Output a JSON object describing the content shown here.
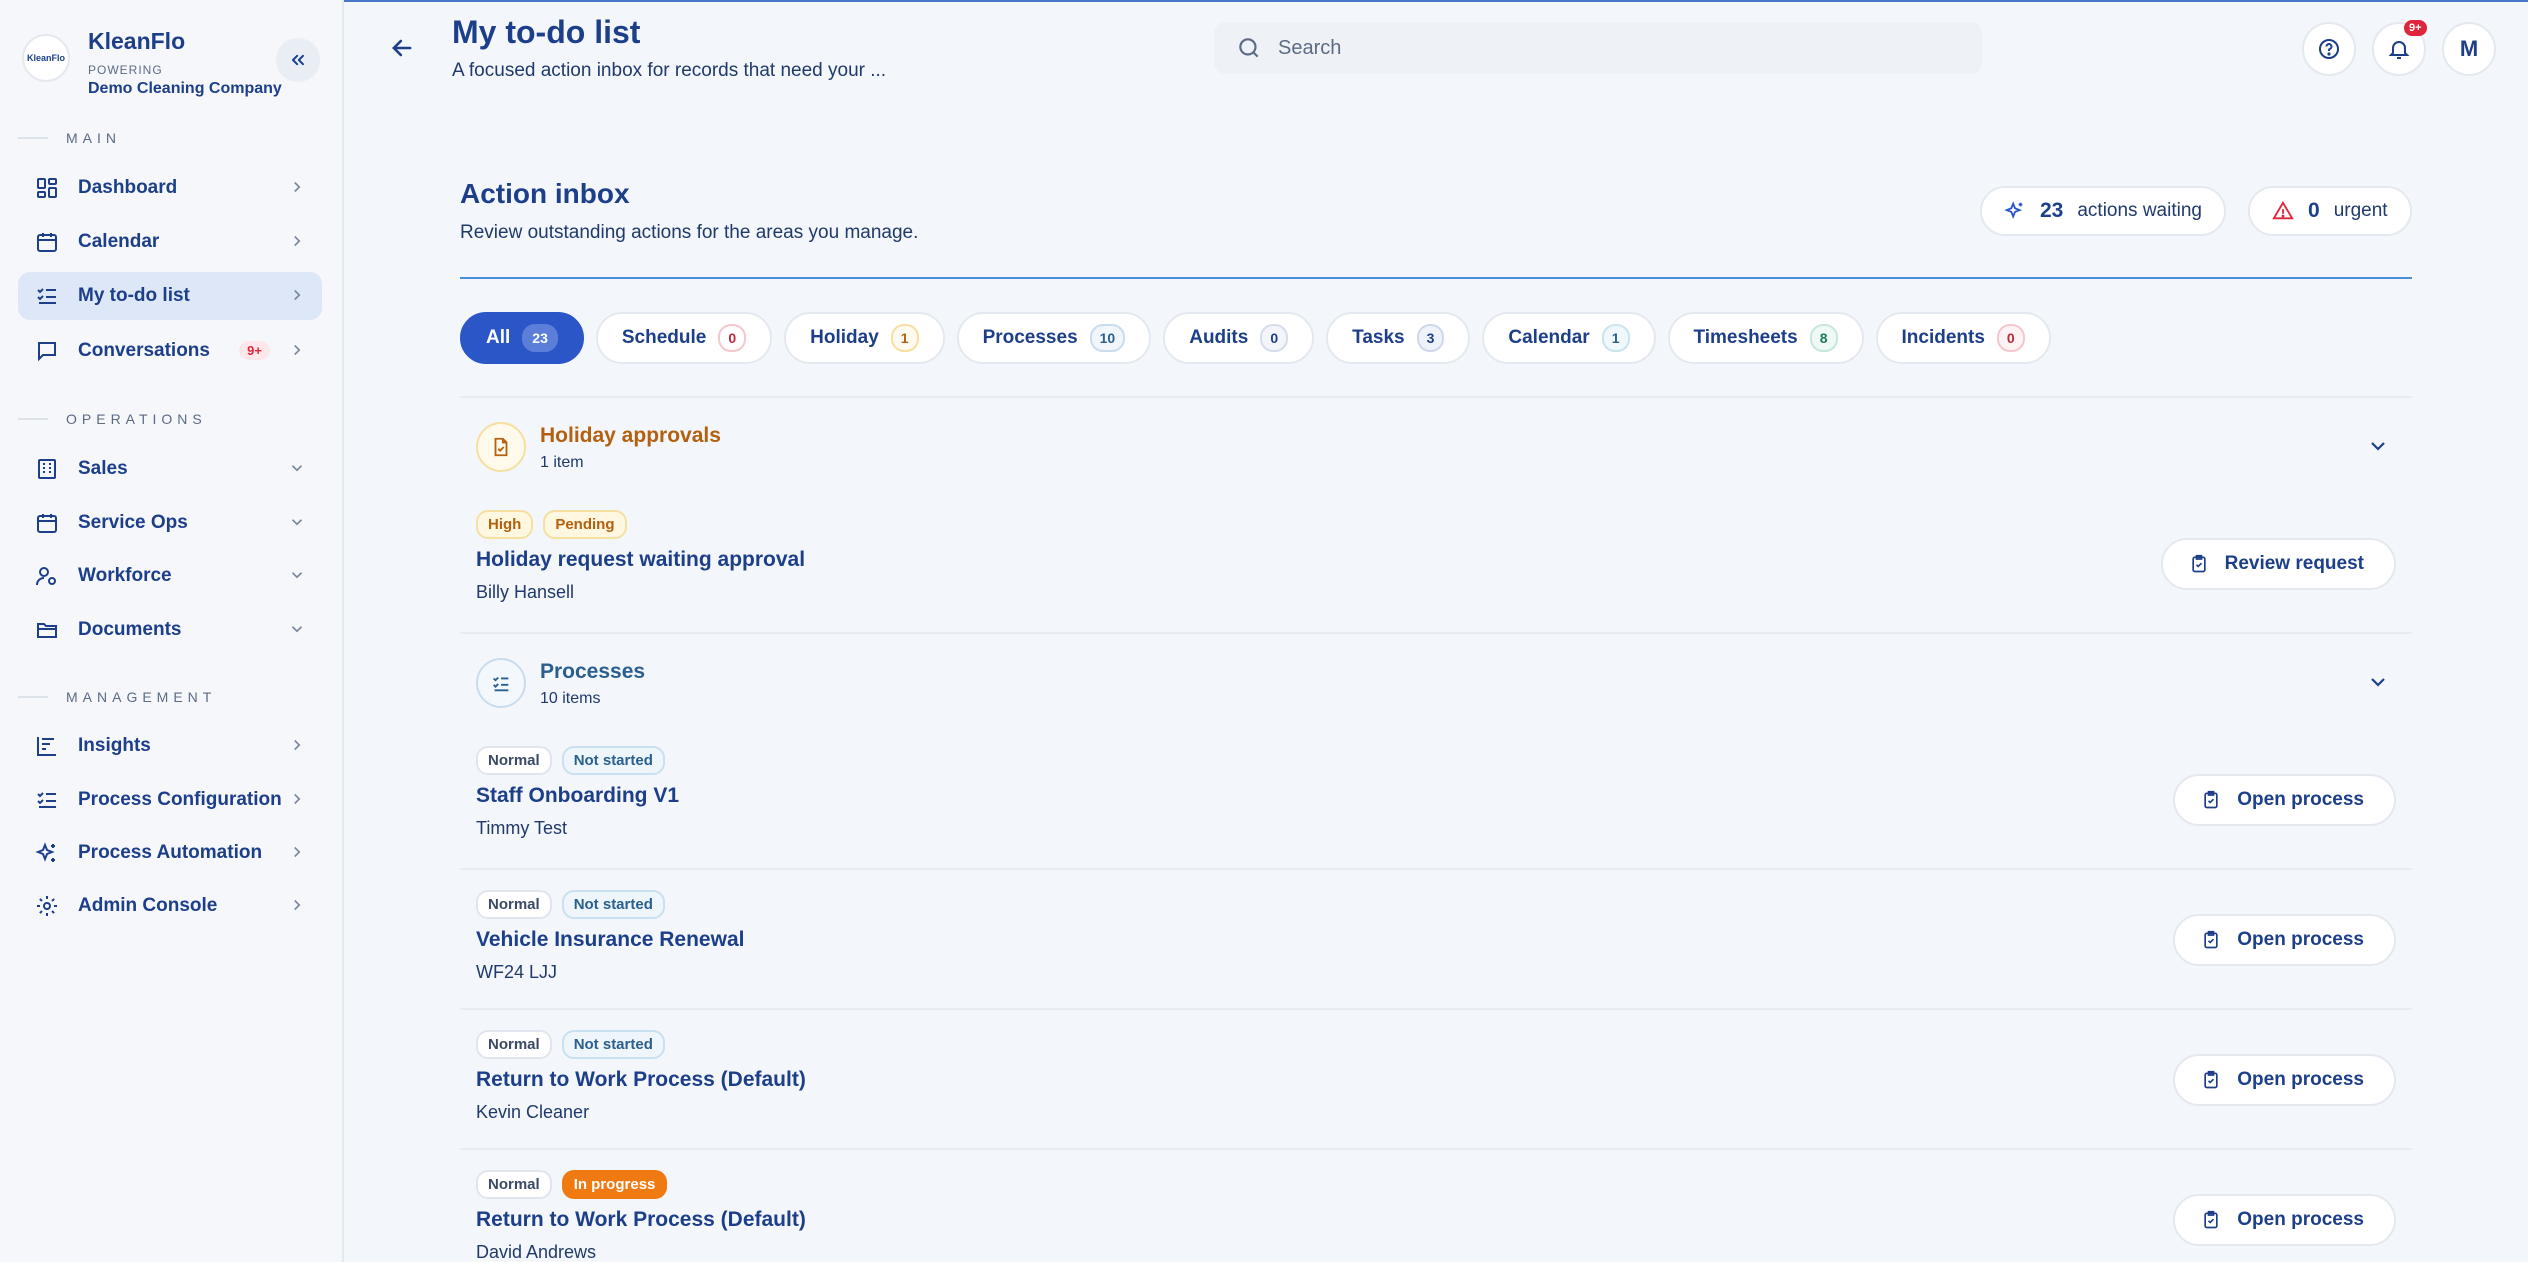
{
  "brand": {
    "logo_text": "KleanFlo",
    "name": "KleanFlo",
    "powering": "POWERING",
    "company": "Demo Cleaning Company"
  },
  "nav": {
    "sections": {
      "main": "MAIN",
      "operations": "OPERATIONS",
      "management": "MANAGEMENT"
    },
    "items": [
      {
        "label": "Dashboard",
        "icon": "dashboard-icon"
      },
      {
        "label": "Calendar",
        "icon": "calendar-icon"
      },
      {
        "label": "My to-do list",
        "icon": "checklist-icon",
        "active": true
      },
      {
        "label": "Conversations",
        "icon": "chat-icon",
        "badge": "9+"
      },
      {
        "label": "Sales",
        "icon": "building-icon"
      },
      {
        "label": "Service Ops",
        "icon": "calendar-icon"
      },
      {
        "label": "Workforce",
        "icon": "user-gear-icon"
      },
      {
        "label": "Documents",
        "icon": "folder-icon"
      },
      {
        "label": "Insights",
        "icon": "chart-icon"
      },
      {
        "label": "Process Configuration",
        "icon": "checklist-icon"
      },
      {
        "label": "Process Automation",
        "icon": "sparkles-icon"
      },
      {
        "label": "Admin Console",
        "icon": "gear-icon"
      }
    ]
  },
  "header": {
    "title": "My to-do list",
    "subtitle": "A focused action inbox for records that need your ...",
    "search_placeholder": "Search",
    "notifications_badge": "9+",
    "avatar": "M"
  },
  "inbox": {
    "title": "Action inbox",
    "description": "Review outstanding actions for the areas you manage.",
    "actions_waiting_count": "23",
    "actions_waiting_label": "actions waiting",
    "urgent_count": "0",
    "urgent_label": "urgent"
  },
  "filters": [
    {
      "label": "All",
      "count": "23"
    },
    {
      "label": "Schedule",
      "count": "0"
    },
    {
      "label": "Holiday",
      "count": "1"
    },
    {
      "label": "Processes",
      "count": "10"
    },
    {
      "label": "Audits",
      "count": "0"
    },
    {
      "label": "Tasks",
      "count": "3"
    },
    {
      "label": "Calendar",
      "count": "1"
    },
    {
      "label": "Timesheets",
      "count": "8"
    },
    {
      "label": "Incidents",
      "count": "0"
    }
  ],
  "groups": [
    {
      "title": "Holiday approvals",
      "count": "1 item",
      "items": [
        {
          "priority": "High",
          "status": "Pending",
          "title": "Holiday request waiting approval",
          "subtitle": "Billy Hansell",
          "action": "Review request"
        }
      ]
    },
    {
      "title": "Processes",
      "count": "10 items",
      "items": [
        {
          "priority": "Normal",
          "status": "Not started",
          "title": "Staff Onboarding V1",
          "subtitle": "Timmy Test",
          "action": "Open process"
        },
        {
          "priority": "Normal",
          "status": "Not started",
          "title": "Vehicle Insurance Renewal",
          "subtitle": "WF24 LJJ",
          "action": "Open process"
        },
        {
          "priority": "Normal",
          "status": "Not started",
          "title": "Return to Work Process (Default)",
          "subtitle": "Kevin Cleaner",
          "action": "Open process"
        },
        {
          "priority": "Normal",
          "status": "In progress",
          "title": "Return to Work Process (Default)",
          "subtitle": "David Andrews",
          "action": "Open process"
        }
      ]
    }
  ],
  "colors": {
    "accent": "#2b56c8",
    "navy": "#1d3f8a",
    "holiday": "#b5600e",
    "process": "#2a5f8f",
    "urgent_red": "#e0243b",
    "in_progress": "#f07a12"
  }
}
